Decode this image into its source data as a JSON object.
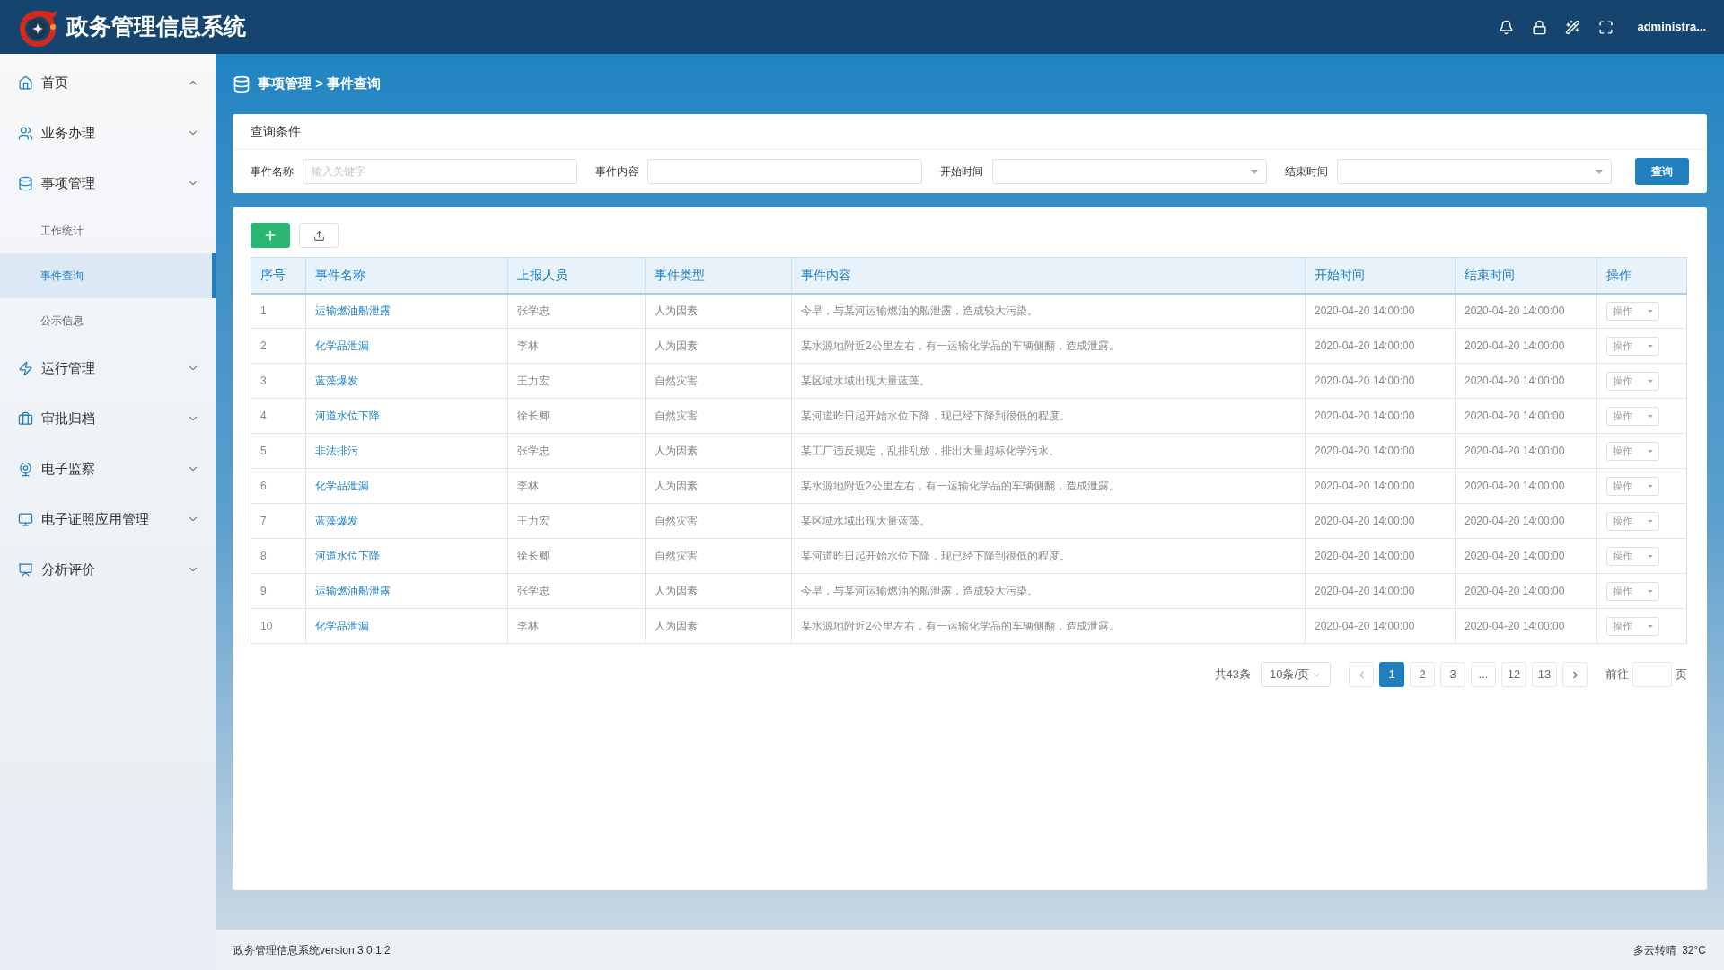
{
  "header": {
    "title": "政务管理信息系统",
    "user": "administra..."
  },
  "sidebar": {
    "items": [
      {
        "label": "首页",
        "expanded": true,
        "selected": false
      },
      {
        "label": "业务办理",
        "expanded": false,
        "selected": false
      },
      {
        "label": "事项管理",
        "expanded": false,
        "selected": false,
        "children": [
          {
            "label": "工作统计",
            "selected": false
          },
          {
            "label": "事件查询",
            "selected": true
          },
          {
            "label": "公示信息",
            "selected": false
          }
        ]
      },
      {
        "label": "运行管理",
        "expanded": false,
        "selected": false
      },
      {
        "label": "审批归档",
        "expanded": false,
        "selected": false
      },
      {
        "label": "电子监察",
        "expanded": false,
        "selected": false
      },
      {
        "label": "电子证照应用管理",
        "expanded": false,
        "selected": false
      },
      {
        "label": "分析评价",
        "expanded": false,
        "selected": false
      }
    ]
  },
  "breadcrumb": "事项管理 > 事件查询",
  "query": {
    "title": "查询条件",
    "fields": [
      {
        "label": "事件名称",
        "kind": "text",
        "placeholder": "输入关键字"
      },
      {
        "label": "事件内容",
        "kind": "text"
      },
      {
        "label": "开始时间",
        "kind": "date"
      },
      {
        "label": "结束时间",
        "kind": "date"
      }
    ],
    "button": "查询"
  },
  "table": {
    "columns": [
      "序号",
      "事件名称",
      "上报人员",
      "事件类型",
      "事件内容",
      "开始时间",
      "结束时间",
      "操作"
    ],
    "rows": [
      {
        "cells": [
          "1",
          "运输燃油船泄露",
          "张学忠",
          "人为因素",
          "今早，与某河运输燃油的船泄露，造成较大污染。",
          "2020-04-20 14:00:00",
          "2020-04-20 14:00:00"
        ],
        "action": "操作"
      },
      {
        "cells": [
          "2",
          "化学品泄漏",
          "李林",
          "人为因素",
          "某水源地附近2公里左右，有一运输化学品的车辆侧翻，造成泄露。",
          "2020-04-20 14:00:00",
          "2020-04-20 14:00:00"
        ],
        "action": "操作"
      },
      {
        "cells": [
          "3",
          "蓝藻爆发",
          "王力宏",
          "自然灾害",
          "某区域水域出现大量蓝藻。",
          "2020-04-20 14:00:00",
          "2020-04-20 14:00:00"
        ],
        "action": "操作"
      },
      {
        "cells": [
          "4",
          "河道水位下降",
          "徐长卿",
          "自然灾害",
          "某河道昨日起开始水位下降，现已经下降到很低的程度。",
          "2020-04-20 14:00:00",
          "2020-04-20 14:00:00"
        ],
        "action": "操作"
      },
      {
        "cells": [
          "5",
          "非法排污",
          "张学忠",
          "人为因素",
          "某工厂违反规定，乱排乱放，排出大量超标化学污水。",
          "2020-04-20 14:00:00",
          "2020-04-20 14:00:00"
        ],
        "action": "操作"
      },
      {
        "cells": [
          "6",
          "化学品泄漏",
          "李林",
          "人为因素",
          "某水源地附近2公里左右，有一运输化学品的车辆侧翻，造成泄露。",
          "2020-04-20 14:00:00",
          "2020-04-20 14:00:00"
        ],
        "action": "操作"
      },
      {
        "cells": [
          "7",
          "蓝藻爆发",
          "王力宏",
          "自然灾害",
          "某区域水域出现大量蓝藻。",
          "2020-04-20 14:00:00",
          "2020-04-20 14:00:00"
        ],
        "action": "操作"
      },
      {
        "cells": [
          "8",
          "河道水位下降",
          "徐长卿",
          "自然灾害",
          "某河道昨日起开始水位下降，现已经下降到很低的程度。",
          "2020-04-20 14:00:00",
          "2020-04-20 14:00:00"
        ],
        "action": "操作"
      },
      {
        "cells": [
          "9",
          "运输燃油船泄露",
          "张学忠",
          "人为因素",
          "今早，与某河运输燃油的船泄露，造成较大污染。",
          "2020-04-20 14:00:00",
          "2020-04-20 14:00:00"
        ],
        "action": "操作"
      },
      {
        "cells": [
          "10",
          "化学品泄漏",
          "李林",
          "人为因素",
          "某水源地附近2公里左右，有一运输化学品的车辆侧翻，造成泄露。",
          "2020-04-20 14:00:00",
          "2020-04-20 14:00:00"
        ],
        "action": "操作"
      }
    ]
  },
  "pagination": {
    "total": "共43条",
    "page_size": "10条/页",
    "pages": [
      {
        "label": "1",
        "selected": true
      },
      {
        "label": "2",
        "selected": false
      },
      {
        "label": "3",
        "selected": false
      },
      {
        "label": "...",
        "selected": false
      },
      {
        "label": "12",
        "selected": false
      },
      {
        "label": "13",
        "selected": false
      }
    ],
    "goto_label": "前往",
    "goto_suffix": "页"
  },
  "footer": {
    "version": "政务管理信息系统version 3.0.1.2",
    "weather": "多云转晴  32°C"
  }
}
